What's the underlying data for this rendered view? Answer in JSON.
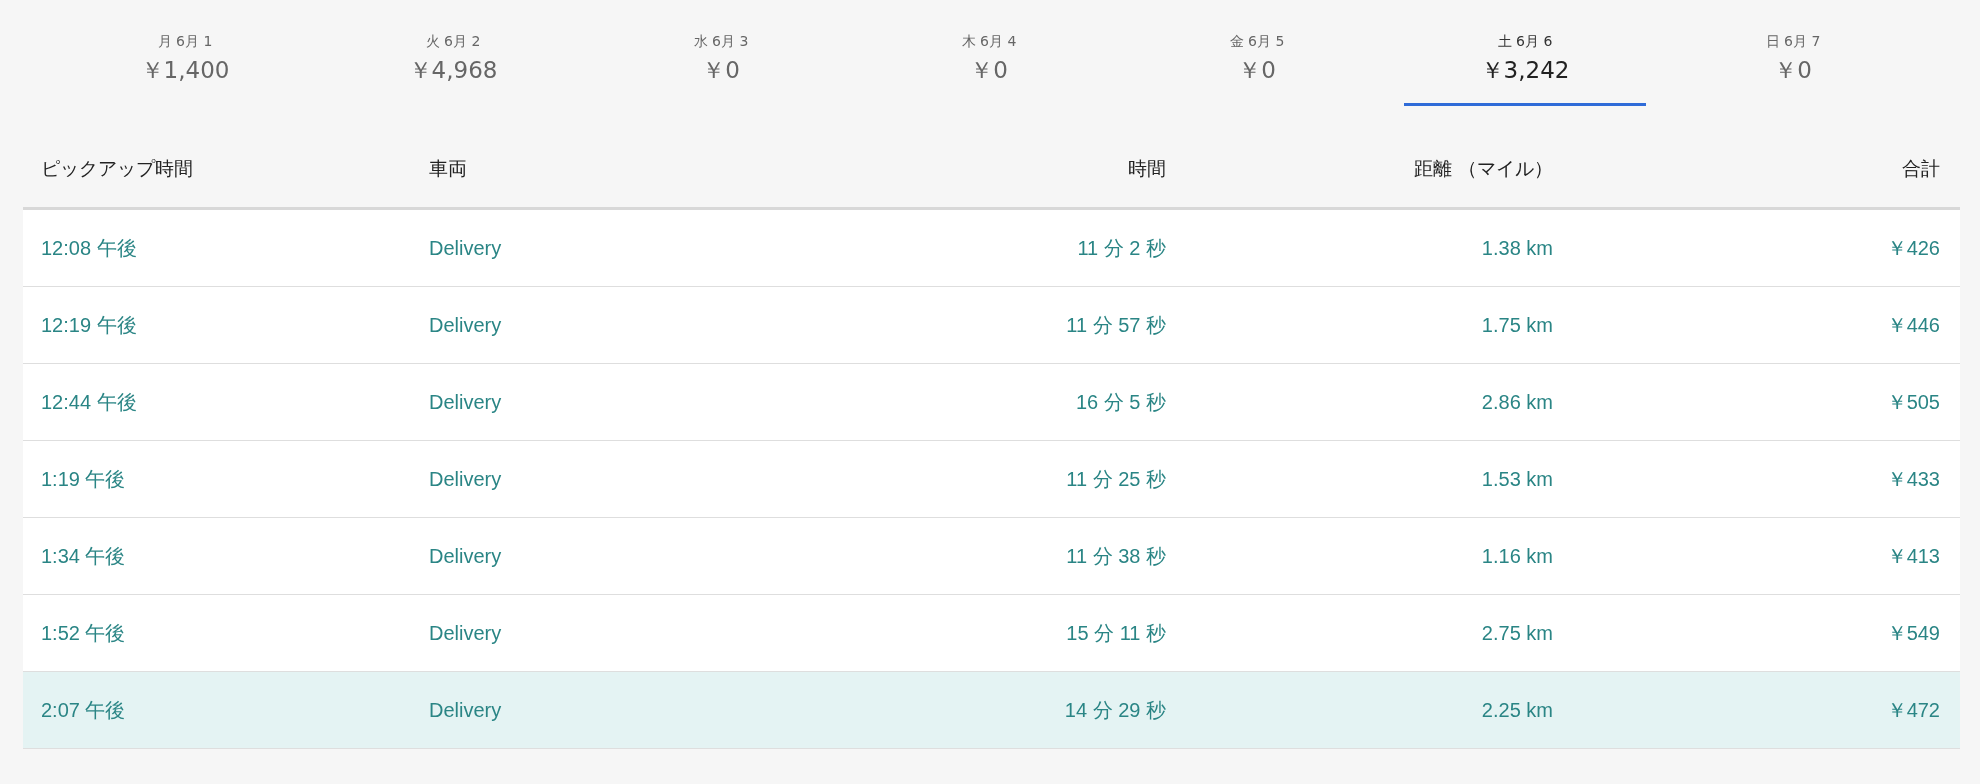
{
  "days": [
    {
      "label": "月 6月 1",
      "amount": "￥1,400",
      "selected": false
    },
    {
      "label": "火 6月 2",
      "amount": "￥4,968",
      "selected": false
    },
    {
      "label": "水 6月 3",
      "amount": "￥0",
      "selected": false
    },
    {
      "label": "木 6月 4",
      "amount": "￥0",
      "selected": false
    },
    {
      "label": "金 6月 5",
      "amount": "￥0",
      "selected": false
    },
    {
      "label": "土 6月 6",
      "amount": "￥3,242",
      "selected": true
    },
    {
      "label": "日 6月 7",
      "amount": "￥0",
      "selected": false
    }
  ],
  "table": {
    "columns": [
      "ピックアップ時間",
      "車両",
      "時間",
      "距離 （マイル）",
      "合計"
    ],
    "rows": [
      {
        "cells": [
          "12:08 午後",
          "Delivery",
          "11 分 2 秒",
          "1.38 km",
          "￥426"
        ],
        "selected": false
      },
      {
        "cells": [
          "12:19 午後",
          "Delivery",
          "11 分 57 秒",
          "1.75 km",
          "￥446"
        ],
        "selected": false
      },
      {
        "cells": [
          "12:44 午後",
          "Delivery",
          "16 分 5 秒",
          "2.86 km",
          "￥505"
        ],
        "selected": false
      },
      {
        "cells": [
          "1:19 午後",
          "Delivery",
          "11 分 25 秒",
          "1.53 km",
          "￥433"
        ],
        "selected": false
      },
      {
        "cells": [
          "1:34 午後",
          "Delivery",
          "11 分 38 秒",
          "1.16 km",
          "￥413"
        ],
        "selected": false
      },
      {
        "cells": [
          "1:52 午後",
          "Delivery",
          "15 分 11 秒",
          "2.75 km",
          "￥549"
        ],
        "selected": false
      },
      {
        "cells": [
          "2:07 午後",
          "Delivery",
          "14 分 29 秒",
          "2.25 km",
          "￥472"
        ],
        "selected": true
      }
    ]
  }
}
